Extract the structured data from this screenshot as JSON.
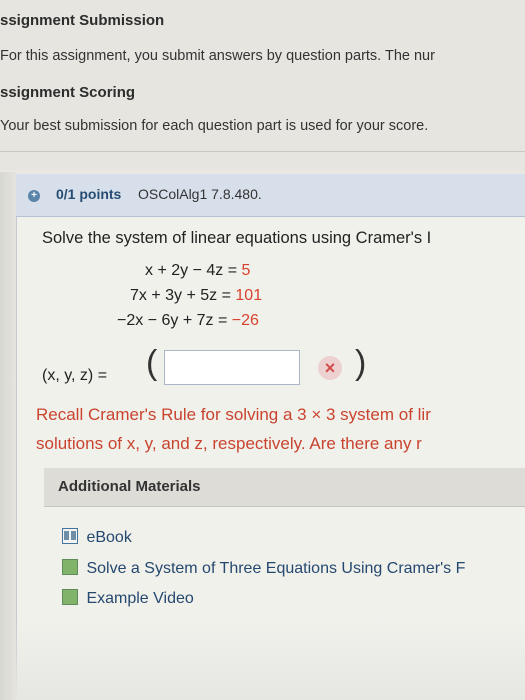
{
  "header": {
    "assignment_submission_title": "ssignment Submission",
    "assignment_submission_text": "For this assignment, you submit answers by question parts. The nur",
    "assignment_scoring_title": "ssignment Scoring",
    "assignment_scoring_text": "Your best submission for each question part is used for your score."
  },
  "question": {
    "points": "0/1 points",
    "code": "OSColAlg1 7.8.480.",
    "prompt": "Solve the system of linear equations using Cramer's I",
    "equations": [
      {
        "lhs": "x + 2y − 4z =",
        "rhs": "5"
      },
      {
        "lhs": "7x + 3y + 5z =",
        "rhs": "101"
      },
      {
        "lhs": "−2x − 6y + 7z =",
        "rhs": "−26"
      }
    ],
    "answer_label": "(x, y, z) =",
    "open_paren": "(",
    "close_paren": ")",
    "answer_value": "",
    "wrong_mark": "×",
    "hint_line1": "Recall Cramer's Rule for solving a 3 × 3 system of lir",
    "hint_line2": "solutions of x, y, and z, respectively. Are there any r"
  },
  "additional_materials": {
    "title": "Additional Materials",
    "items": [
      {
        "label": "eBook",
        "icon": "book-icon"
      },
      {
        "label": "Solve a System of Three Equations Using Cramer's F",
        "icon": "video-icon"
      },
      {
        "label": "Example Video",
        "icon": "video-icon"
      }
    ]
  },
  "colors": {
    "question_bar": "#d7e0ea",
    "rhs_red": "#d7422e",
    "link_blue": "#25486f",
    "points_blue": "#274c72"
  }
}
